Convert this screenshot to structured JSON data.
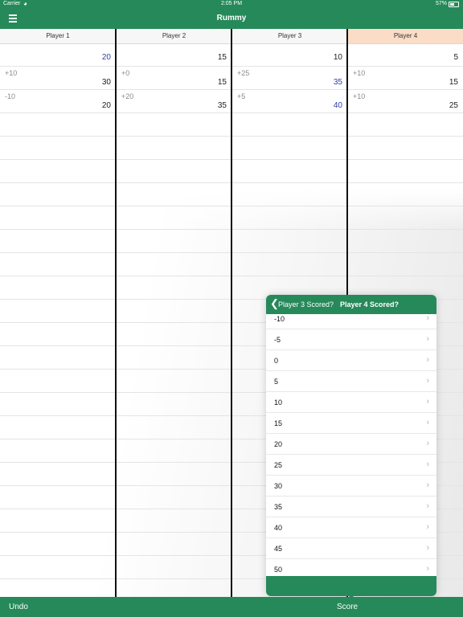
{
  "status_bar": {
    "carrier": "Carrier",
    "time": "2:05 PM",
    "battery": "57%"
  },
  "nav": {
    "title": "Rummy"
  },
  "players": [
    {
      "name": "Player 1",
      "active": false,
      "rows": [
        {
          "delta": "",
          "total": "20",
          "blue": true
        },
        {
          "delta": "+10",
          "total": "30",
          "blue": false
        },
        {
          "delta": "-10",
          "total": "20",
          "blue": false
        }
      ]
    },
    {
      "name": "Player 2",
      "active": false,
      "rows": [
        {
          "delta": "",
          "total": "15",
          "blue": false
        },
        {
          "delta": "+0",
          "total": "15",
          "blue": false
        },
        {
          "delta": "+20",
          "total": "35",
          "blue": false
        }
      ]
    },
    {
      "name": "Player 3",
      "active": false,
      "rows": [
        {
          "delta": "",
          "total": "10",
          "blue": false
        },
        {
          "delta": "+25",
          "total": "35",
          "blue": true
        },
        {
          "delta": "+5",
          "total": "40",
          "blue": true
        }
      ]
    },
    {
      "name": "Player 4",
      "active": true,
      "rows": [
        {
          "delta": "",
          "total": "5",
          "blue": false
        },
        {
          "delta": "+10",
          "total": "15",
          "blue": false
        },
        {
          "delta": "+10",
          "total": "25",
          "blue": false
        }
      ]
    }
  ],
  "popover": {
    "back_label": "Player 3 Scored?",
    "title": "Player 4 Scored?",
    "options": [
      "-10",
      "-5",
      "0",
      "5",
      "10",
      "15",
      "20",
      "25",
      "30",
      "35",
      "40",
      "45",
      "50"
    ]
  },
  "tab_bar": {
    "undo_label": "Undo",
    "score_label": "Score"
  },
  "colors": {
    "brand_green": "#26895a",
    "active_header": "#fbdcc6",
    "highlight_blue": "#2b3fa3"
  }
}
